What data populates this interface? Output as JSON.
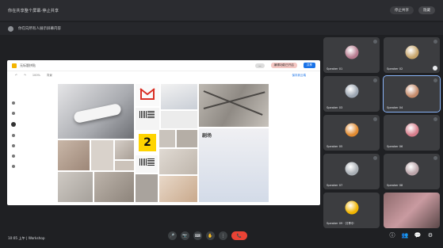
{
  "topbar": {
    "title": "你在共享整个屏幕·停止共享",
    "pill_stop": "停止共享",
    "pill_hide": "隐藏"
  },
  "subbar": {
    "text": "你在向所有人展示屏幕内容"
  },
  "presentation": {
    "doc_title": "无标题拼贴",
    "top_pill": "—",
    "center_pill": "编辑功能已开启",
    "share_label": "共享",
    "sub_toolbar": [
      "↶",
      "↷",
      "100%",
      "背景"
    ],
    "sub_toolbar_right": "保存到云端"
  },
  "collage": {
    "number_badge": "2",
    "poster_title": "剧场"
  },
  "participants": [
    {
      "name": "Speaker 01",
      "avatar_color": "#b57a8e"
    },
    {
      "name": "Speaker 02",
      "avatar_color": "#c6a46a"
    },
    {
      "name": "Speaker 03",
      "avatar_color": "#9aa4b0"
    },
    {
      "name": "Speaker 04",
      "avatar_color": "#c48a6a"
    },
    {
      "name": "Speaker 05",
      "avatar_color": "#e0892f"
    },
    {
      "name": "Speaker 06",
      "avatar_color": "#d57c8a"
    },
    {
      "name": "Speaker 07",
      "avatar_color": "#a7adb3"
    },
    {
      "name": "Speaker 08",
      "avatar_color": "#b9a3a8"
    },
    {
      "name": "Speaker 09 · 共享中",
      "avatar_color": "#f0b400"
    },
    {
      "name": "",
      "avatar_color": "#7b5c5a"
    }
  ],
  "bottombar": {
    "meeting_info": "10:05 上午  |  Workshop",
    "controls": [
      "🎤",
      "📷",
      "⌨",
      "✋",
      "⋮"
    ],
    "end_call_icon": "📞",
    "right_controls": [
      "ⓘ",
      "👥",
      "💬",
      "⚙"
    ]
  },
  "colors": {
    "background": "#1f2023",
    "end_call": "#ea4335",
    "active_outline": "#8ab4f8"
  }
}
